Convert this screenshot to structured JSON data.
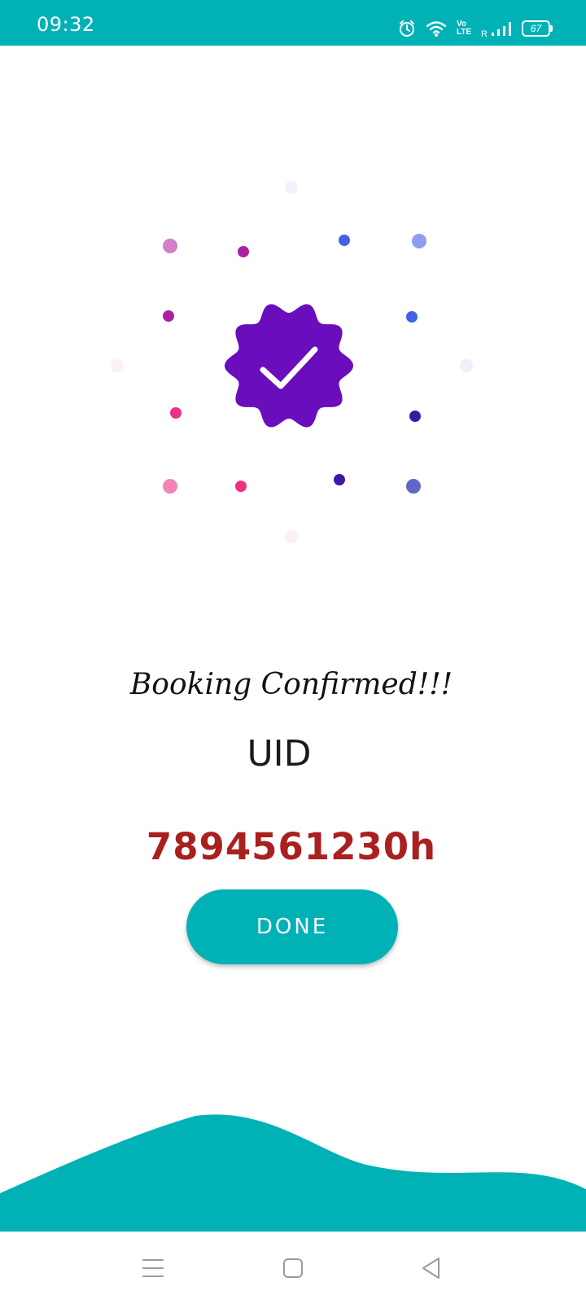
{
  "status_bar": {
    "time": "09:32",
    "battery": "67",
    "icons": [
      "alarm-icon",
      "wifi-icon",
      "volte-icon",
      "roaming-indicator",
      "signal-icon",
      "battery-icon"
    ],
    "volte_text": "Vo LTE",
    "roaming_text": "R"
  },
  "confirmation": {
    "title": "Booking Confirmed!!!",
    "uid_label": "UID",
    "uid_value": "7894561230h",
    "done_label": "DONE"
  },
  "colors": {
    "accent": "#00b2b6",
    "badge": "#6a0dbd",
    "uid_value": "#a9201f"
  },
  "nav_bar": {
    "icons": [
      "menu-icon",
      "home-square-icon",
      "back-triangle-icon"
    ]
  }
}
